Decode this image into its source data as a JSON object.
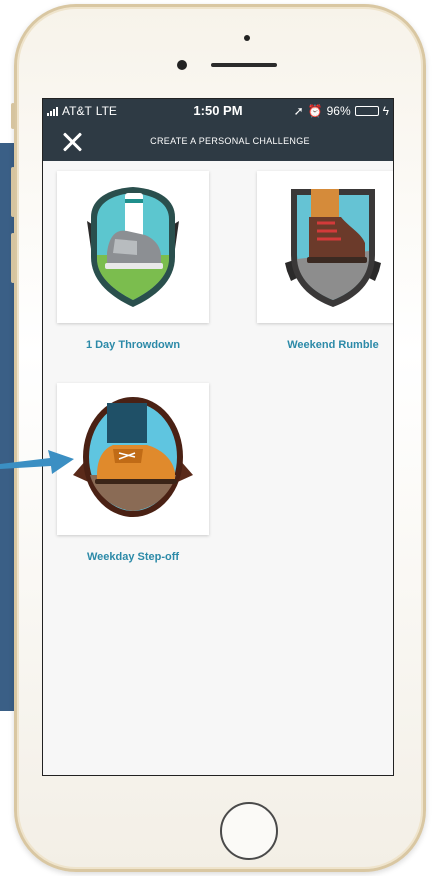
{
  "status_bar": {
    "carrier": "AT&T",
    "network": "LTE",
    "time": "1:50 PM",
    "battery": "96%",
    "battery_level": 0.96
  },
  "nav": {
    "title": "CREATE A PERSONAL CHALLENGE",
    "close_icon": "close-icon"
  },
  "challenges": [
    {
      "label": "1 Day Throwdown",
      "icon": "sneaker-badge-icon"
    },
    {
      "label": "Weekend Rumble",
      "icon": "hiking-boot-badge-icon"
    },
    {
      "label": "Weekday Step-off",
      "icon": "dress-shoe-badge-icon"
    }
  ],
  "colors": {
    "nav_bg": "#2e3a44",
    "label": "#2c8aa8",
    "arrow": "#3b8fc3",
    "side_panel": "#3a5f86"
  }
}
